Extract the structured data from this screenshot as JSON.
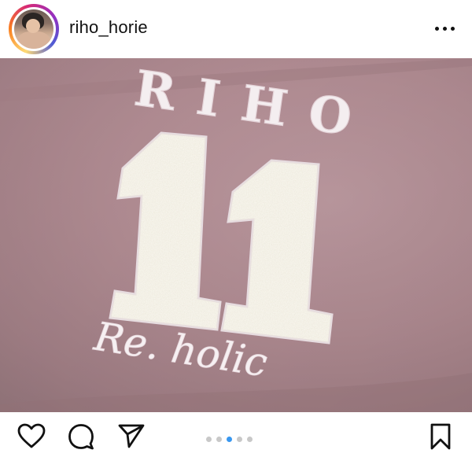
{
  "header": {
    "username": "riho_horie",
    "avatar_icon": "profile-avatar",
    "more_icon": "ellipsis-icon"
  },
  "photo": {
    "embroidery_name": "RIHO",
    "patch_number": "11",
    "script_text": "Re. holic",
    "fabric_color": "#b8939a",
    "patch_color": "#f3f1e8"
  },
  "actions": {
    "like_icon": "heart-icon",
    "comment_icon": "comment-icon",
    "share_icon": "send-icon",
    "save_icon": "bookmark-icon",
    "carousel_total": 5,
    "carousel_active": 3
  },
  "colors": {
    "accent": "#3897f0",
    "text": "#111111"
  }
}
